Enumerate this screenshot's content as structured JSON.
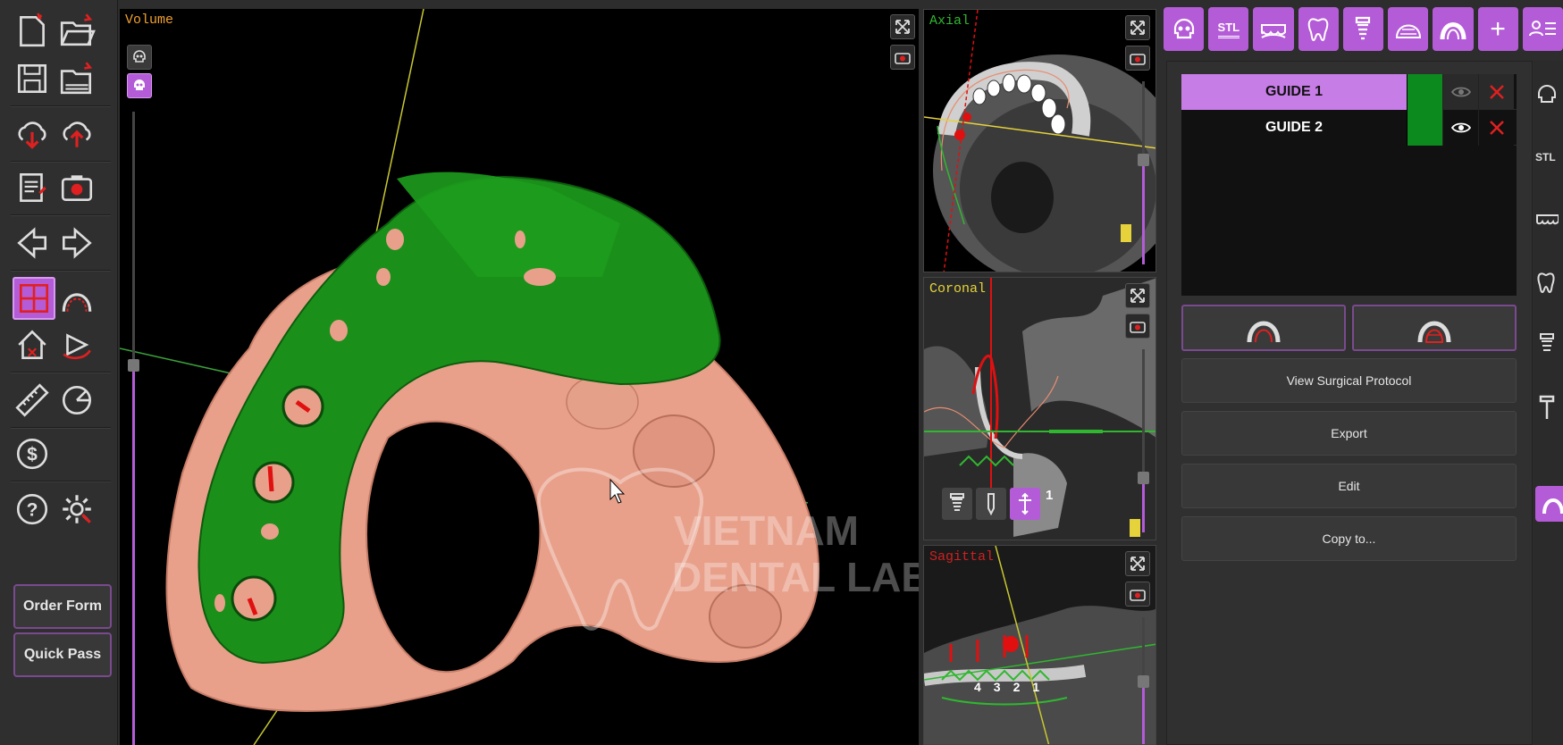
{
  "left_toolbar": {
    "icons": [
      "new-file-icon",
      "open-folder-icon",
      "save-icon",
      "open-recent-icon",
      "cloud-download-icon",
      "cloud-upload-icon",
      "report-icon",
      "screenshot-icon",
      "arrow-left-icon",
      "arrow-right-icon",
      "layout-quad-icon",
      "arch-curve-icon",
      "home-view-icon",
      "rotate-view-icon",
      "ruler-icon",
      "protractor-icon",
      "dollar-icon",
      "help-icon",
      "settings-icon"
    ],
    "order_form_label": "Order Form",
    "quick_pass_label": "Quick Pass"
  },
  "volume_view": {
    "label": "Volume",
    "label_color": "#f0a030",
    "watermark": "VIETNAM\nDENTAL LAB",
    "slider_level": 0.6
  },
  "axial_view": {
    "label": "Axial",
    "label_color": "#2fb82f",
    "slider_level": 0.57
  },
  "coronal_view": {
    "label": "Coronal",
    "label_color": "#e6d23a",
    "tool_number": "1",
    "slider_level": 0.3
  },
  "sagittal_view": {
    "label": "Sagittal",
    "label_color": "#d02020",
    "tooth_numbers": [
      "4",
      "3",
      "2",
      "1"
    ],
    "slider_level": 0.5
  },
  "top_toolbar": {
    "items": [
      {
        "icon": "skull-icon",
        "text": ""
      },
      {
        "icon": "stl-icon",
        "text": "STL"
      },
      {
        "icon": "teeth-row-icon",
        "text": ""
      },
      {
        "icon": "tooth-icon",
        "text": ""
      },
      {
        "icon": "implant-icon",
        "text": ""
      },
      {
        "icon": "arch-dome-icon",
        "text": ""
      },
      {
        "icon": "guide-arch-icon",
        "text": ""
      },
      {
        "icon": "plus-icon",
        "text": "+"
      },
      {
        "icon": "patient-list-icon",
        "text": ""
      }
    ]
  },
  "guides": [
    {
      "name": "GUIDE 1",
      "selected": true,
      "color": "#0c8a1e",
      "visible": false
    },
    {
      "name": "GUIDE 2",
      "selected": false,
      "color": "#0c8a1e",
      "visible": true
    }
  ],
  "actions": {
    "view_protocol": "View Surgical Protocol",
    "export": "Export",
    "edit": "Edit",
    "copy_to": "Copy to..."
  },
  "right_strip": {
    "stl_label": "STL"
  },
  "colors": {
    "accent": "#b45cd8",
    "guide_green": "#0c8a1e",
    "bone": "#e8a08a",
    "background": "#000000"
  }
}
